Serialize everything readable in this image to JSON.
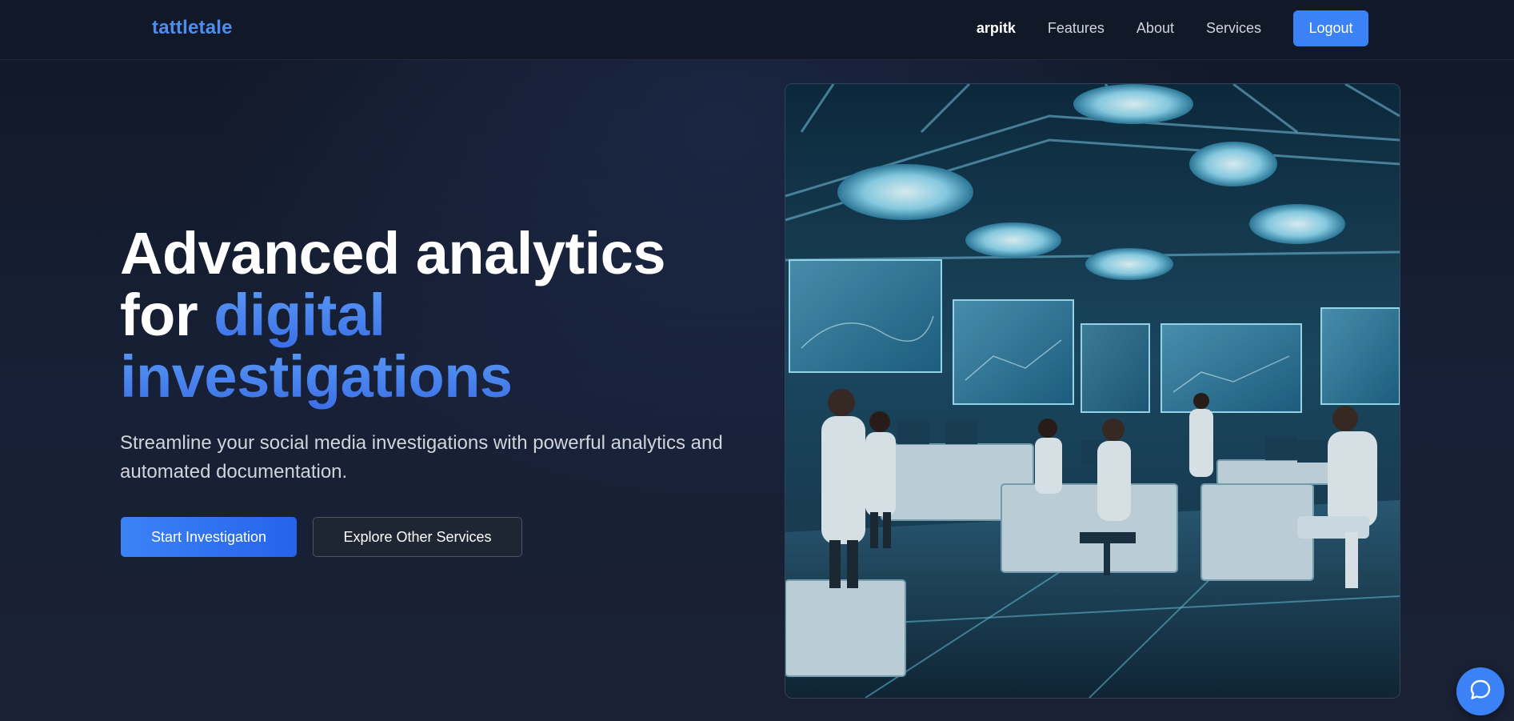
{
  "header": {
    "logo": "tattletale",
    "username": "arpitk",
    "nav": [
      "Features",
      "About",
      "Services"
    ],
    "logout_label": "Logout"
  },
  "hero": {
    "title_line1": "Advanced analytics",
    "title_line2_plain": "for ",
    "title_line2_accent": "digital",
    "title_line3_accent": "investigations",
    "subtitle": "Streamline your social media investigations with powerful analytics and automated documentation.",
    "primary_cta": "Start Investigation",
    "secondary_cta": "Explore Other Services"
  },
  "image": {
    "subject": "futuristic-forensics-lab"
  },
  "chat": {
    "icon": "chat-bubble-icon"
  },
  "colors": {
    "accent": "#3b82f6",
    "background": "#141b2d",
    "header_bg": "#111827",
    "logo": "#4f8cf0"
  }
}
